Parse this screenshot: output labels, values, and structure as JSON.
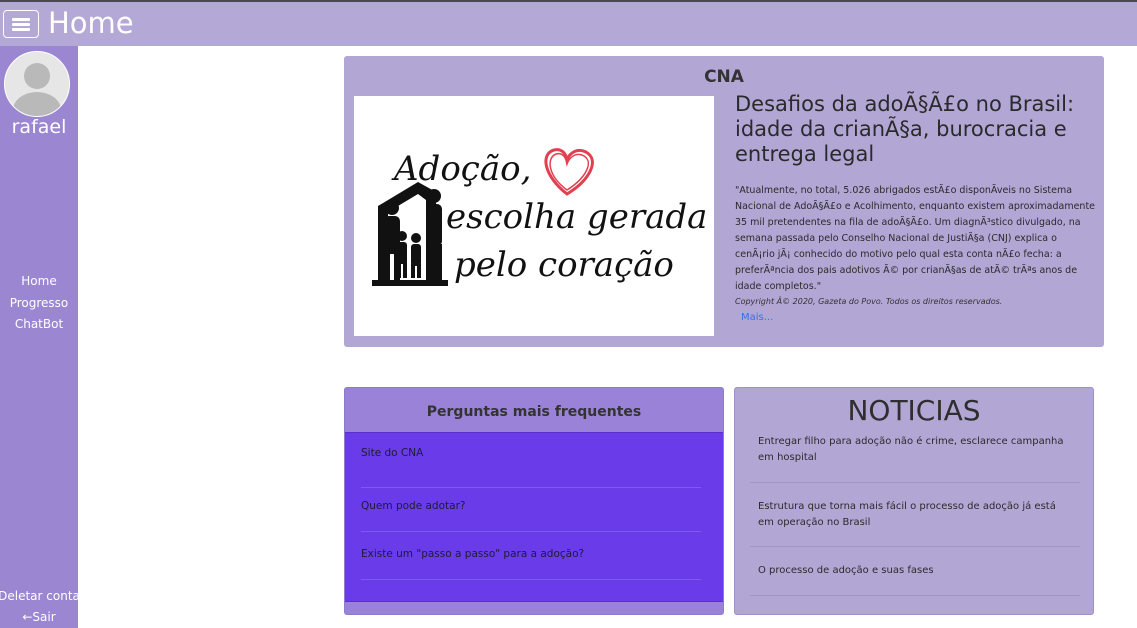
{
  "header": {
    "title": "Home",
    "menu_icon": "hamburger-menu-icon"
  },
  "sidebar": {
    "avatar_icon": "user-avatar-icon",
    "username": "rafael",
    "nav": [
      {
        "label": "Home"
      },
      {
        "label": "Progresso"
      },
      {
        "label": "ChatBot"
      }
    ],
    "delete_account": "Deletar conta",
    "logout": "←Sair"
  },
  "cna": {
    "title": "CNA",
    "image_text": [
      "Adoção,",
      "escolha gerada",
      "pelo coração"
    ],
    "headline": "Desafios da adoÃ§Ã£o no Brasil: idade da crianÃ§a, burocracia e entrega legal",
    "body": "\"Atualmente, no total, 5.026 abrigados estÃ£o disponÃveis no Sistema Nacional de AdoÃ§Ã£o e Acolhimento, enquanto existem aproximadamente 35 mil pretendentes na fila de adoÃ§Ã£o. Um diagnÃ³stico divulgado, na semana passada pelo Conselho Nacional de JustiÃ§a (CNJ) explica o cenÃ¡rio jÃ¡ conhecido do motivo pelo qual esta conta nÃ£o fecha: a preferÃªncia dos pais adotivos Ã© por crianÃ§as de atÃ© trÃªs anos de idade completos.\"",
    "copyright": "Copyright Â© 2020, Gazeta do Povo. Todos os direitos reservados.",
    "more_link": "Mais..."
  },
  "faq": {
    "title": "Perguntas mais frequentes",
    "items": [
      {
        "label": "Site do CNA"
      },
      {
        "label": "Quem pode adotar?"
      },
      {
        "label": "Existe um \"passo a passo\" para a adoção?"
      }
    ]
  },
  "news": {
    "title": "NOTICIAS",
    "items": [
      {
        "label": "Entregar filho para adoção não é crime, esclarece campanha em hospital"
      },
      {
        "label": "Estrutura que torna mais fácil o processo de adoção já está em operação no Brasil"
      },
      {
        "label": "O processo de adoção e suas fases"
      }
    ]
  },
  "colors": {
    "header": "#b3a8d6",
    "sidebar": "#9b86d1",
    "card": "#b2a6d5",
    "faq_list": "#6a3be8",
    "heart": "#e04050"
  }
}
